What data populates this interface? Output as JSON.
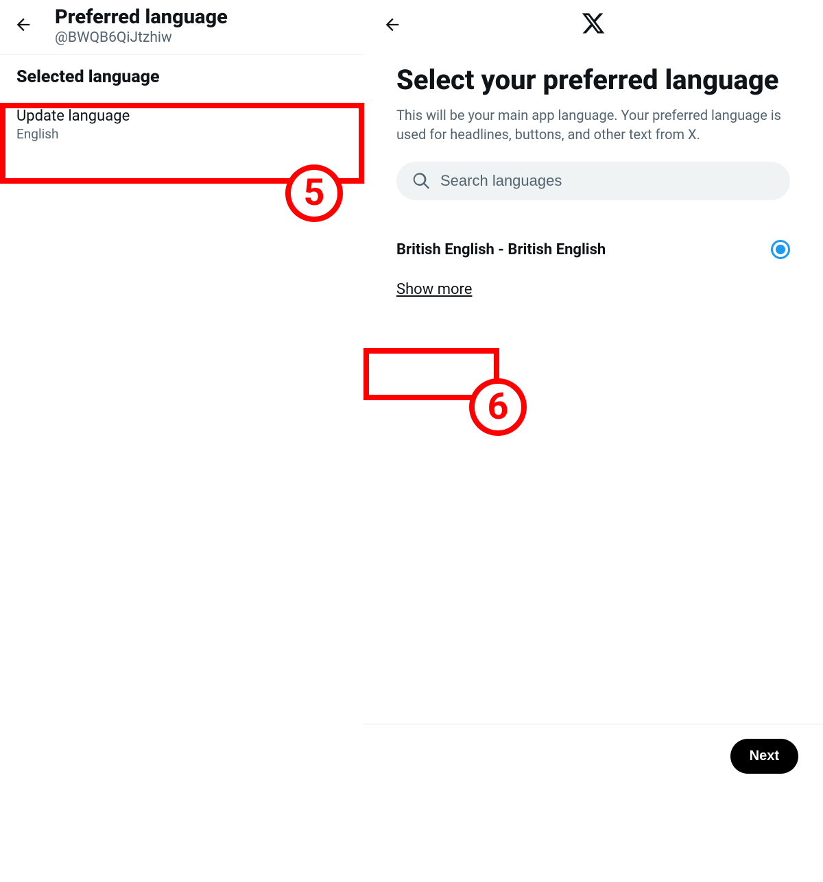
{
  "left": {
    "title": "Preferred language",
    "handle": "@BWQB6QiJtzhiw",
    "section_heading": "Selected language",
    "update": {
      "label": "Update language",
      "value": "English"
    }
  },
  "right": {
    "title": "Select your preferred language",
    "description": "This will be your main app language. Your preferred language is used for headlines, buttons, and other text from X.",
    "search_placeholder": "Search languages",
    "option": {
      "label": "British English - British English",
      "selected": true
    },
    "show_more": "Show more",
    "next": "Next"
  },
  "annotations": {
    "step5": "5",
    "step6": "6"
  }
}
